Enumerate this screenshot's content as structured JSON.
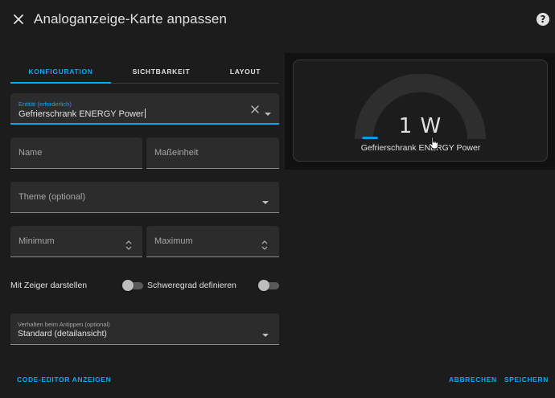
{
  "dialog": {
    "title": "Analoganzeige-Karte anpassen",
    "close_icon": "close-icon",
    "help_label": "?"
  },
  "tabs": [
    {
      "label": "KONFIGURATION",
      "active": true
    },
    {
      "label": "SICHTBARKEIT",
      "active": false
    },
    {
      "label": "LAYOUT",
      "active": false
    }
  ],
  "form": {
    "entity": {
      "label": "Entität (erforderlich)",
      "value": "Gefrierschrank ENERGY Power"
    },
    "name": {
      "label": "Name",
      "value": ""
    },
    "unit": {
      "label": "Maßeinheit",
      "value": ""
    },
    "theme": {
      "label": "Theme (optional)",
      "value": ""
    },
    "minimum": {
      "label": "Minimum",
      "value": ""
    },
    "maximum": {
      "label": "Maximum",
      "value": ""
    },
    "needle": {
      "label": "Mit Zeiger darstellen",
      "checked": false
    },
    "severity": {
      "label": "Schweregrad definieren",
      "checked": false
    },
    "tap_action": {
      "label": "Verhalten beim Antippen (optional)",
      "value": "Standard (detailansicht)"
    }
  },
  "footer": {
    "code_editor": "CODE-EDITOR ANZEIGEN",
    "cancel": "ABBRECHEN",
    "save": "SPEICHERN"
  },
  "preview": {
    "value": "1 W",
    "name": "Gefrierschrank ENERGY Power",
    "level": 0.06,
    "accent_color": "#039be5",
    "track_color": "#2e2e2e"
  },
  "colors": {
    "accent": "#03a9f4",
    "background": "#1c1c1c",
    "field": "#2c2c2c"
  }
}
